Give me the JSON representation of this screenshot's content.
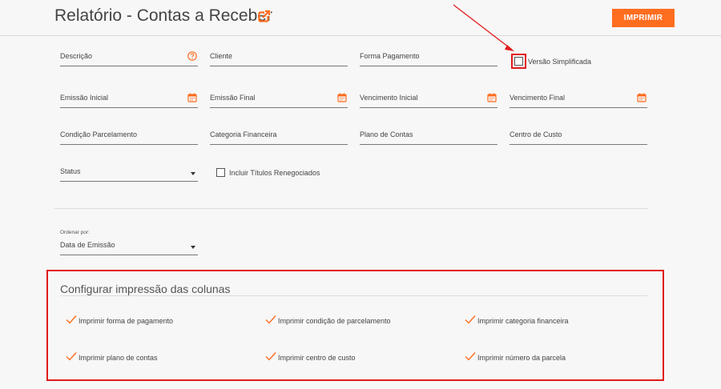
{
  "header": {
    "title": "Relatório - Contas a Receber",
    "print_label": "IMPRIMIR"
  },
  "filters": {
    "row1": {
      "descricao": "Descrição",
      "cliente": "Cliente",
      "forma_pagamento": "Forma Pagamento",
      "versao_simplificada": "Versão Simplificada"
    },
    "row2": {
      "emissao_inicial": "Emissão Inicial",
      "emissao_final": "Emissão Final",
      "vencimento_inicial": "Vencimento Inicial",
      "vencimento_final": "Vencimento Final"
    },
    "row3": {
      "condicao_parcelamento": "Condição Parcelamento",
      "categoria_financeira": "Categoria Financeira",
      "plano_contas": "Plano de Contas",
      "centro_custo": "Centro de Custo"
    },
    "row4": {
      "status": "Status",
      "incluir_renegociados": "Incluir Títulos Renegociados"
    }
  },
  "ordenar": {
    "label": "Ordenar por:",
    "value": "Data de Emissão"
  },
  "config": {
    "title": "Configurar impressão das colunas",
    "options": [
      "Imprimir forma de pagamento",
      "Imprimir condição de parcelamento",
      "Imprimir categoria financeira",
      "Imprimir plano de contas",
      "Imprimir centro de custo",
      "Imprimir número da parcela"
    ]
  },
  "colors": {
    "accent": "#ff6d1f",
    "highlight": "#e01b1b"
  },
  "icons": {
    "title": "external-link-icon",
    "descricao": "help-circle-icon",
    "date": "calendar-icon",
    "select": "caret-down-icon",
    "option": "check-icon"
  }
}
